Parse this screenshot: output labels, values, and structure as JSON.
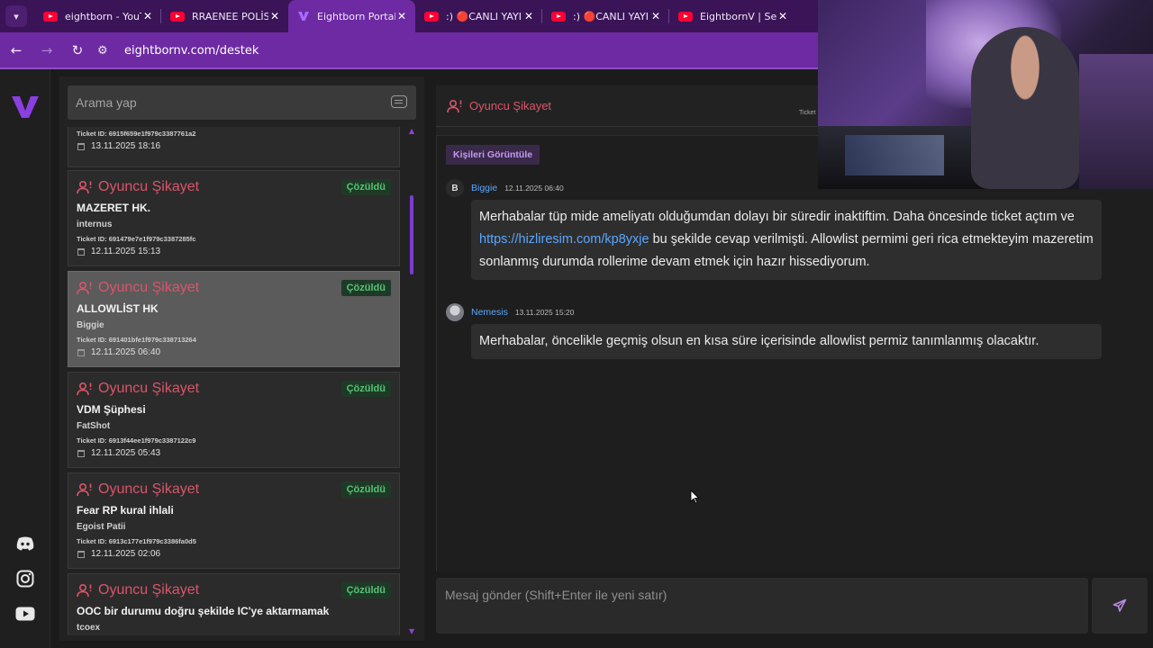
{
  "browser": {
    "tabs": [
      {
        "label": "eightborn - YouT",
        "favicon": "youtube-icon",
        "active": false
      },
      {
        "label": "RRAENEE POLİS",
        "favicon": "youtube-icon",
        "active": false
      },
      {
        "label": "Eightborn Portal",
        "favicon": "eightborn-v-icon",
        "active": true
      },
      {
        "label": ":) 🔴CANLI YAYI",
        "favicon": "youtube-icon",
        "active": false
      },
      {
        "label": ":) 🔴CANLI YAYI",
        "favicon": "youtube-icon",
        "active": false
      },
      {
        "label": "EightbornV | Ser",
        "favicon": "youtube-icon",
        "active": false
      }
    ],
    "url": "eightbornv.com/destek"
  },
  "sidebar": {
    "items": [
      "eightborn-logo",
      "discord-icon",
      "instagram-icon",
      "youtube-icon"
    ]
  },
  "search": {
    "placeholder": "Arama yap"
  },
  "tickets": {
    "category_label": "Oyuncu Şikayet",
    "status_label": "Çözüldü",
    "partial_top": {
      "ticket_id": "Ticket ID: 6915f659e1f979c3387761a2",
      "date": "13.11.2025 18:16"
    },
    "items": [
      {
        "title": "MAZERET HK.",
        "user": "internus",
        "ticket_id": "Ticket ID: 691479e7e1f979c3387285fc",
        "date": "12.11.2025 15:13",
        "selected": false
      },
      {
        "title": "ALLOWLİST HK",
        "user": "Biggie",
        "ticket_id": "Ticket ID: 691401bfe1f979c338713264",
        "date": "12.11.2025 06:40",
        "selected": true
      },
      {
        "title": "VDM Şüphesi",
        "user": "FatShot",
        "ticket_id": "Ticket ID: 6913f44ee1f979c3387122c9",
        "date": "12.11.2025 05:43",
        "selected": false
      },
      {
        "title": "Fear RP kural ihlali",
        "user": "Egoist Patii",
        "ticket_id": "Ticket ID: 6913c177e1f979c3386fa0d5",
        "date": "12.11.2025 02:06",
        "selected": false
      },
      {
        "title": "OOC bir durumu doğru şekilde IC'ye aktarmamak",
        "user": "tcoex",
        "ticket_id": "",
        "date": "",
        "selected": false
      }
    ]
  },
  "conversation": {
    "header": "Oyuncu Şikayet",
    "ticket_ref": "Ticket",
    "people_button": "Kişileri Görüntüle",
    "messages": [
      {
        "avatar_letter": "B",
        "author": "Biggie",
        "time": "12.11.2025 06:40",
        "text_before": "Merhabalar tüp mide ameliyatı olduğumdan dolayı bir süredir inaktiftim. Daha öncesinde ticket açtım ve ",
        "link": "https://hizliresim.com/kp8yxje",
        "text_after": " bu şekilde cevap verilmişti. Allowlist permimi geri rica etmekteyim mazeretim sonlanmış durumda rollerime devam etmek için hazır hissediyorum."
      },
      {
        "avatar_letter": "",
        "author": "Nemesis",
        "time": "13.11.2025 15:20",
        "text_before": "Merhabalar, öncelikle geçmiş olsun en kısa süre içerisinde allowlist permiz tanımlanmış olacaktır.",
        "link": "",
        "text_after": ""
      }
    ]
  },
  "composer": {
    "placeholder": "Mesaj gönder (Shift+Enter ile yeni satır)"
  },
  "colors": {
    "accent": "#6d2aa3",
    "category": "#d9556a",
    "resolved": "#58c174",
    "link": "#5aa6ff"
  }
}
